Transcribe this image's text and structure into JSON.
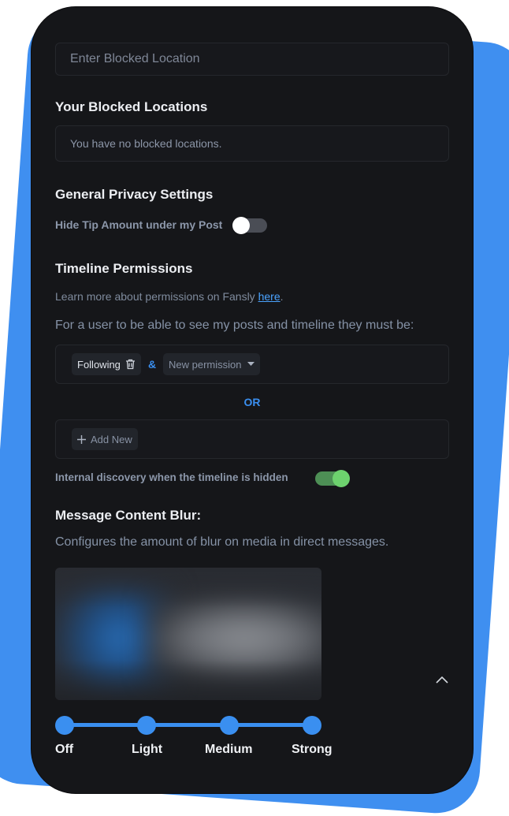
{
  "blocked_location": {
    "placeholder": "Enter Blocked Location",
    "list_title": "Your Blocked Locations",
    "empty_text": "You have no blocked locations."
  },
  "general_privacy": {
    "title": "General Privacy Settings",
    "hide_tip_label": "Hide Tip Amount under my Post",
    "hide_tip_enabled": false
  },
  "timeline_permissions": {
    "title": "Timeline Permissions",
    "learn_more_prefix": "Learn more about permissions on Fansly ",
    "learn_more_link": "here",
    "learn_more_suffix": ".",
    "requirement_text": "For a user to be able to see my posts and timeline they must be:",
    "group1": {
      "chip_label": "Following",
      "and_label": "&",
      "new_permission_label": "New permission"
    },
    "or_label": "OR",
    "add_new_label": "Add New",
    "internal_discovery_label": "Internal discovery when the timeline is hidden",
    "internal_discovery_enabled": true
  },
  "message_blur": {
    "title": "Message Content Blur:",
    "description": "Configures the amount of blur on media in direct messages.",
    "levels": [
      "Off",
      "Light",
      "Medium",
      "Strong"
    ]
  },
  "colors": {
    "accent": "#3a8ff0",
    "toggle_on": "#6dd26e",
    "link": "#4aa3ff",
    "background": "#151619"
  },
  "icons": {
    "trash": "trash-icon",
    "caret": "caret-down-icon",
    "plus": "plus-icon",
    "scroll_top": "chevron-up-icon"
  }
}
